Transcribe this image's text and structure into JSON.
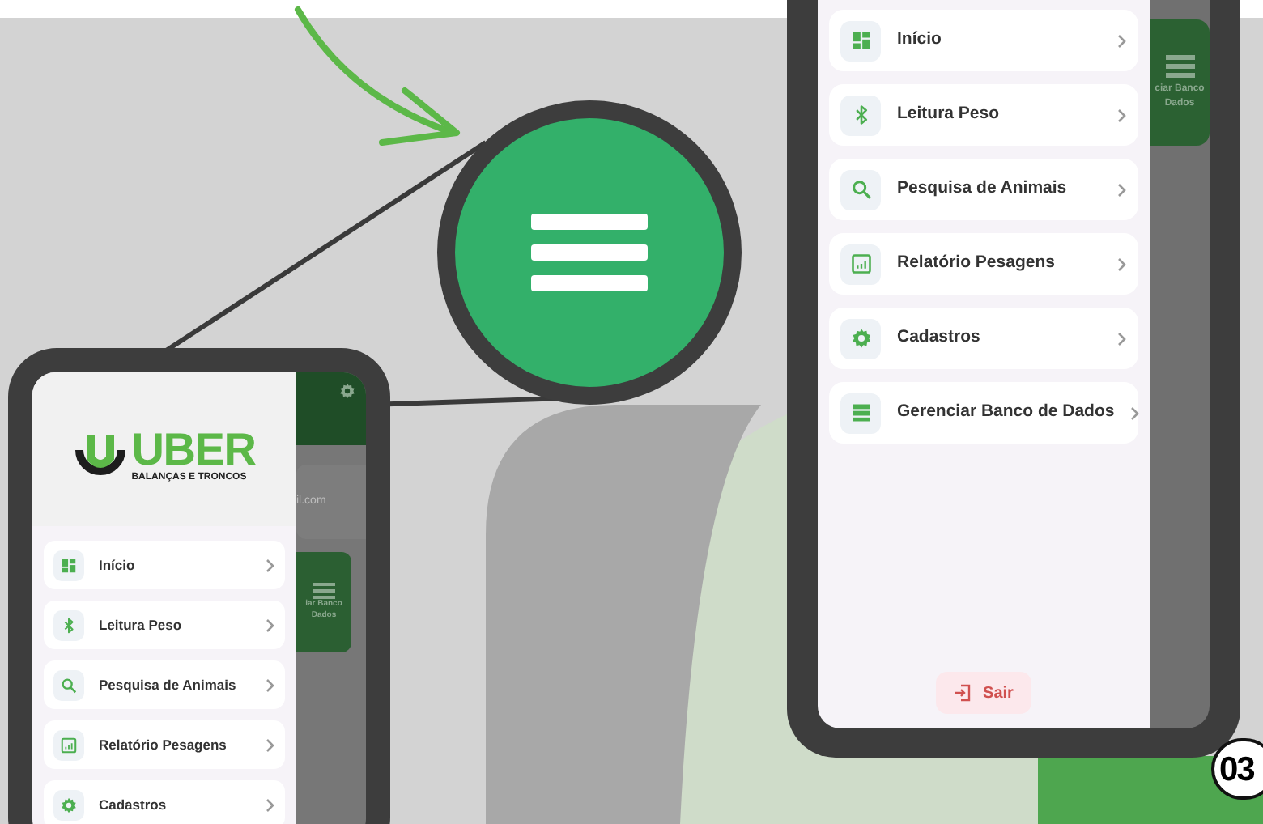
{
  "left_phone": {
    "logo": {
      "name": "UBER",
      "tagline": "BALANÇAS E TRONCOS"
    },
    "background": {
      "email_fragment": "il.com",
      "card_label": [
        "iar Banco",
        "Dados"
      ]
    },
    "menu": [
      {
        "kind": "dashboard",
        "label": "Início"
      },
      {
        "kind": "bluetooth",
        "label": "Leitura Peso"
      },
      {
        "kind": "search",
        "label": "Pesquisa de Animais"
      },
      {
        "kind": "report",
        "label": "Relatório Pesagens"
      },
      {
        "kind": "settings",
        "label": "Cadastros"
      }
    ]
  },
  "right_phone": {
    "background": {
      "card_label": [
        "ciar Banco",
        "Dados"
      ]
    },
    "menu": [
      {
        "kind": "dashboard",
        "label": "Início"
      },
      {
        "kind": "bluetooth",
        "label": "Leitura Peso"
      },
      {
        "kind": "search",
        "label": "Pesquisa de Animais"
      },
      {
        "kind": "report",
        "label": "Relatório Pesagens"
      },
      {
        "kind": "settings",
        "label": "Cadastros"
      },
      {
        "kind": "database",
        "label": "Gerenciar Banco de Dados"
      }
    ],
    "logout": "Sair"
  },
  "step_badge": "03"
}
